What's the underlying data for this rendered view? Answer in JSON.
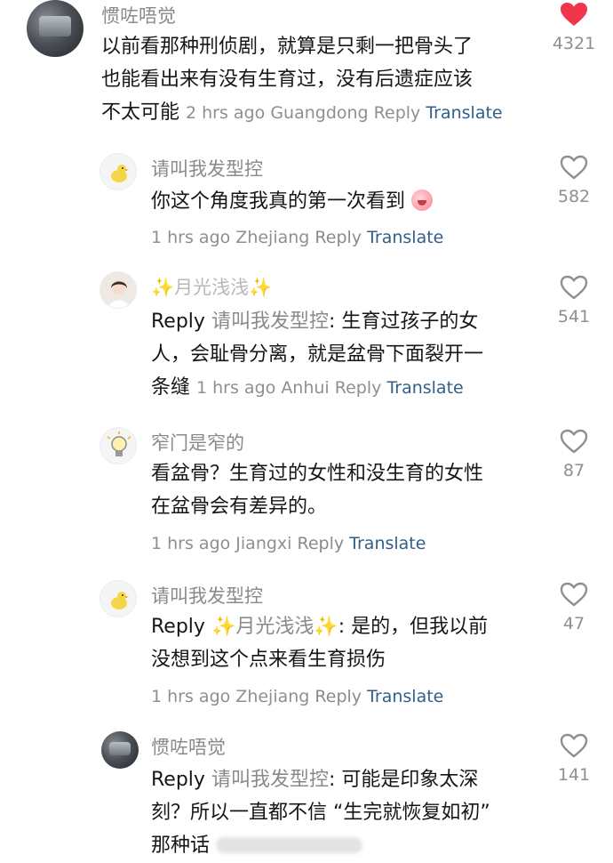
{
  "comments": [
    {
      "username": "惯咗唔觉",
      "lines": [
        "以前看那种刑侦剧，就算是只剩一把骨头了",
        "也能看出来有没有生育过，没有后遗症应该",
        "不太可能"
      ],
      "time": "2 hrs ago",
      "location": "Guangdong",
      "reply": "Reply",
      "translate": "Translate",
      "likes": "4321",
      "liked": true
    },
    {
      "username": "请叫我发型控",
      "lines": [
        "你这个角度我真的第一次看到"
      ],
      "time": "1 hrs ago",
      "location": "Zhejiang",
      "reply": "Reply",
      "translate": "Translate",
      "likes": "582"
    },
    {
      "username": "✨月光浅浅✨",
      "reply_prefix": "Reply",
      "reply_to": "请叫我发型控",
      "lines": [
        ": 生育过孩子的女",
        "人，会耻骨分离，就是盆骨下面裂开一",
        "条缝"
      ],
      "time": "1 hrs ago",
      "location": "Anhui",
      "reply": "Reply",
      "translate": "Translate",
      "likes": "541"
    },
    {
      "username": "窄门是窄的",
      "lines": [
        "看盆骨？生育过的女性和没生育的女性",
        "在盆骨会有差异的。"
      ],
      "time": "1 hrs ago",
      "location": "Jiangxi",
      "reply": "Reply",
      "translate": "Translate",
      "likes": "87"
    },
    {
      "username": "请叫我发型控",
      "reply_prefix": "Reply",
      "reply_to": "✨月光浅浅✨",
      "lines": [
        ": 是的，但我以前",
        "没想到这个点来看生育损伤"
      ],
      "time": "1 hrs ago",
      "location": "Zhejiang",
      "reply": "Reply",
      "translate": "Translate",
      "likes": "47"
    },
    {
      "username": "惯咗唔觉",
      "reply_prefix": "Reply",
      "reply_to": "请叫我发型控",
      "lines": [
        ": 可能是印象太深",
        "刻？所以一直都不信 “生完就恢复如初”",
        "那种话"
      ],
      "likes": "141"
    }
  ],
  "colors": {
    "heart_liked": "#f1354a",
    "translate": "#2f5f8a",
    "muted": "#8f8f8f"
  },
  "icons": {
    "like": "heart-outline-icon",
    "liked": "heart-filled-icon"
  }
}
